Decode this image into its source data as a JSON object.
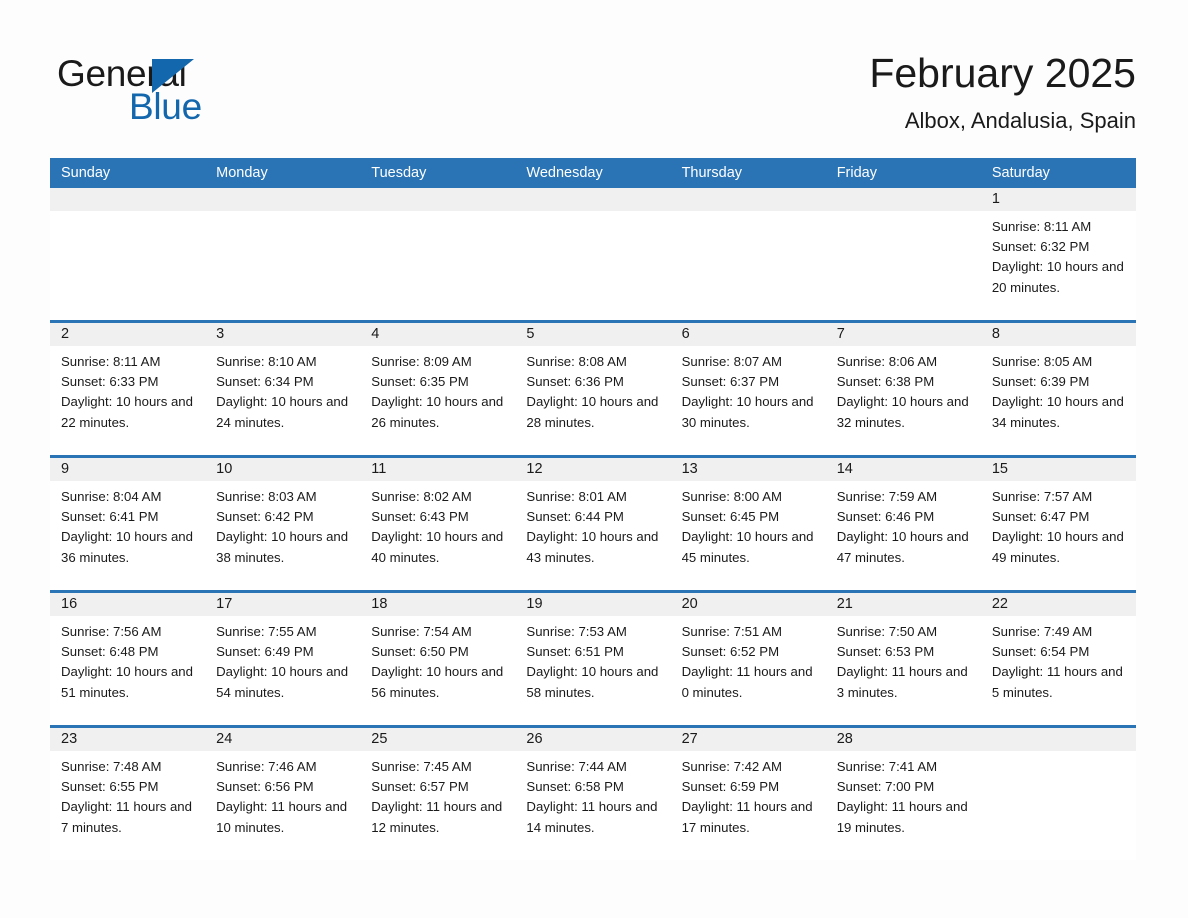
{
  "brand": {
    "name_part1": "General",
    "name_part2": "Blue",
    "triangle_color": "#1367ac",
    "accent_color": "#2a74b5"
  },
  "header": {
    "title": "February 2025",
    "subtitle": "Albox, Andalusia, Spain"
  },
  "weekdays": [
    "Sunday",
    "Monday",
    "Tuesday",
    "Wednesday",
    "Thursday",
    "Friday",
    "Saturday"
  ],
  "weeks": [
    [
      {
        "day": "",
        "sunrise": "",
        "sunset": "",
        "daylight": ""
      },
      {
        "day": "",
        "sunrise": "",
        "sunset": "",
        "daylight": ""
      },
      {
        "day": "",
        "sunrise": "",
        "sunset": "",
        "daylight": ""
      },
      {
        "day": "",
        "sunrise": "",
        "sunset": "",
        "daylight": ""
      },
      {
        "day": "",
        "sunrise": "",
        "sunset": "",
        "daylight": ""
      },
      {
        "day": "",
        "sunrise": "",
        "sunset": "",
        "daylight": ""
      },
      {
        "day": "1",
        "sunrise": "Sunrise: 8:11 AM",
        "sunset": "Sunset: 6:32 PM",
        "daylight": "Daylight: 10 hours and 20 minutes."
      }
    ],
    [
      {
        "day": "2",
        "sunrise": "Sunrise: 8:11 AM",
        "sunset": "Sunset: 6:33 PM",
        "daylight": "Daylight: 10 hours and 22 minutes."
      },
      {
        "day": "3",
        "sunrise": "Sunrise: 8:10 AM",
        "sunset": "Sunset: 6:34 PM",
        "daylight": "Daylight: 10 hours and 24 minutes."
      },
      {
        "day": "4",
        "sunrise": "Sunrise: 8:09 AM",
        "sunset": "Sunset: 6:35 PM",
        "daylight": "Daylight: 10 hours and 26 minutes."
      },
      {
        "day": "5",
        "sunrise": "Sunrise: 8:08 AM",
        "sunset": "Sunset: 6:36 PM",
        "daylight": "Daylight: 10 hours and 28 minutes."
      },
      {
        "day": "6",
        "sunrise": "Sunrise: 8:07 AM",
        "sunset": "Sunset: 6:37 PM",
        "daylight": "Daylight: 10 hours and 30 minutes."
      },
      {
        "day": "7",
        "sunrise": "Sunrise: 8:06 AM",
        "sunset": "Sunset: 6:38 PM",
        "daylight": "Daylight: 10 hours and 32 minutes."
      },
      {
        "day": "8",
        "sunrise": "Sunrise: 8:05 AM",
        "sunset": "Sunset: 6:39 PM",
        "daylight": "Daylight: 10 hours and 34 minutes."
      }
    ],
    [
      {
        "day": "9",
        "sunrise": "Sunrise: 8:04 AM",
        "sunset": "Sunset: 6:41 PM",
        "daylight": "Daylight: 10 hours and 36 minutes."
      },
      {
        "day": "10",
        "sunrise": "Sunrise: 8:03 AM",
        "sunset": "Sunset: 6:42 PM",
        "daylight": "Daylight: 10 hours and 38 minutes."
      },
      {
        "day": "11",
        "sunrise": "Sunrise: 8:02 AM",
        "sunset": "Sunset: 6:43 PM",
        "daylight": "Daylight: 10 hours and 40 minutes."
      },
      {
        "day": "12",
        "sunrise": "Sunrise: 8:01 AM",
        "sunset": "Sunset: 6:44 PM",
        "daylight": "Daylight: 10 hours and 43 minutes."
      },
      {
        "day": "13",
        "sunrise": "Sunrise: 8:00 AM",
        "sunset": "Sunset: 6:45 PM",
        "daylight": "Daylight: 10 hours and 45 minutes."
      },
      {
        "day": "14",
        "sunrise": "Sunrise: 7:59 AM",
        "sunset": "Sunset: 6:46 PM",
        "daylight": "Daylight: 10 hours and 47 minutes."
      },
      {
        "day": "15",
        "sunrise": "Sunrise: 7:57 AM",
        "sunset": "Sunset: 6:47 PM",
        "daylight": "Daylight: 10 hours and 49 minutes."
      }
    ],
    [
      {
        "day": "16",
        "sunrise": "Sunrise: 7:56 AM",
        "sunset": "Sunset: 6:48 PM",
        "daylight": "Daylight: 10 hours and 51 minutes."
      },
      {
        "day": "17",
        "sunrise": "Sunrise: 7:55 AM",
        "sunset": "Sunset: 6:49 PM",
        "daylight": "Daylight: 10 hours and 54 minutes."
      },
      {
        "day": "18",
        "sunrise": "Sunrise: 7:54 AM",
        "sunset": "Sunset: 6:50 PM",
        "daylight": "Daylight: 10 hours and 56 minutes."
      },
      {
        "day": "19",
        "sunrise": "Sunrise: 7:53 AM",
        "sunset": "Sunset: 6:51 PM",
        "daylight": "Daylight: 10 hours and 58 minutes."
      },
      {
        "day": "20",
        "sunrise": "Sunrise: 7:51 AM",
        "sunset": "Sunset: 6:52 PM",
        "daylight": "Daylight: 11 hours and 0 minutes."
      },
      {
        "day": "21",
        "sunrise": "Sunrise: 7:50 AM",
        "sunset": "Sunset: 6:53 PM",
        "daylight": "Daylight: 11 hours and 3 minutes."
      },
      {
        "day": "22",
        "sunrise": "Sunrise: 7:49 AM",
        "sunset": "Sunset: 6:54 PM",
        "daylight": "Daylight: 11 hours and 5 minutes."
      }
    ],
    [
      {
        "day": "23",
        "sunrise": "Sunrise: 7:48 AM",
        "sunset": "Sunset: 6:55 PM",
        "daylight": "Daylight: 11 hours and 7 minutes."
      },
      {
        "day": "24",
        "sunrise": "Sunrise: 7:46 AM",
        "sunset": "Sunset: 6:56 PM",
        "daylight": "Daylight: 11 hours and 10 minutes."
      },
      {
        "day": "25",
        "sunrise": "Sunrise: 7:45 AM",
        "sunset": "Sunset: 6:57 PM",
        "daylight": "Daylight: 11 hours and 12 minutes."
      },
      {
        "day": "26",
        "sunrise": "Sunrise: 7:44 AM",
        "sunset": "Sunset: 6:58 PM",
        "daylight": "Daylight: 11 hours and 14 minutes."
      },
      {
        "day": "27",
        "sunrise": "Sunrise: 7:42 AM",
        "sunset": "Sunset: 6:59 PM",
        "daylight": "Daylight: 11 hours and 17 minutes."
      },
      {
        "day": "28",
        "sunrise": "Sunrise: 7:41 AM",
        "sunset": "Sunset: 7:00 PM",
        "daylight": "Daylight: 11 hours and 19 minutes."
      },
      {
        "day": "",
        "sunrise": "",
        "sunset": "",
        "daylight": ""
      }
    ]
  ]
}
